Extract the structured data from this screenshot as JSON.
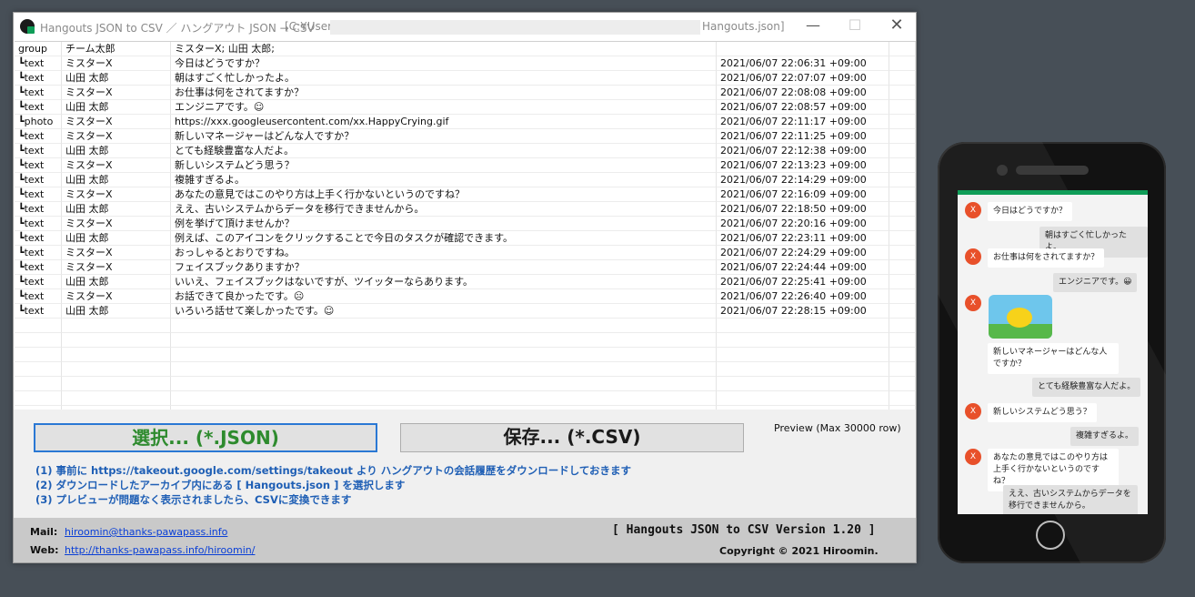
{
  "window": {
    "title": "Hangouts JSON to CSV ／ ハングアウト JSON → CSV",
    "path_prefix": "[C:¥Users",
    "path_suffix": "Hangouts.json]",
    "minimize": "—",
    "maximize": "☐",
    "close": "✕"
  },
  "grid": {
    "rows": [
      {
        "type": "group",
        "user": "チーム太郎",
        "text": "ミスターX; 山田 太郎;",
        "time": ""
      },
      {
        "type": "┗text",
        "user": "ミスターX",
        "text": "今日はどうですか？",
        "time": "2021/06/07 22:06:31 +09:00"
      },
      {
        "type": "┗text",
        "user": "山田 太郎",
        "text": "朝はすごく忙しかったよ。",
        "time": "2021/06/07 22:07:07 +09:00"
      },
      {
        "type": "┗text",
        "user": "ミスターX",
        "text": "お仕事は何をされてますか？",
        "time": "2021/06/07 22:08:08 +09:00"
      },
      {
        "type": "┗text",
        "user": "山田 太郎",
        "text": "エンジニアです。☺",
        "time": "2021/06/07 22:08:57 +09:00"
      },
      {
        "type": "┗photo",
        "user": "ミスターX",
        "text": "https://xxx.googleusercontent.com/xx.HappyCrying.gif",
        "time": "2021/06/07 22:11:17 +09:00"
      },
      {
        "type": "┗text",
        "user": "ミスターX",
        "text": "新しいマネージャーはどんな人ですか？",
        "time": "2021/06/07 22:11:25 +09:00"
      },
      {
        "type": "┗text",
        "user": "山田 太郎",
        "text": "とても経験豊富な人だよ。",
        "time": "2021/06/07 22:12:38 +09:00"
      },
      {
        "type": "┗text",
        "user": "ミスターX",
        "text": "新しいシステムどう思う？",
        "time": "2021/06/07 22:13:23 +09:00"
      },
      {
        "type": "┗text",
        "user": "山田 太郎",
        "text": "複雑すぎるよ。",
        "time": "2021/06/07 22:14:29 +09:00"
      },
      {
        "type": "┗text",
        "user": "ミスターX",
        "text": "あなたの意見ではこのやり方は上手く行かないというのですね？",
        "time": "2021/06/07 22:16:09 +09:00"
      },
      {
        "type": "┗text",
        "user": "山田 太郎",
        "text": "ええ、古いシステムからデータを移行できませんから。",
        "time": "2021/06/07 22:18:50 +09:00"
      },
      {
        "type": "┗text",
        "user": "ミスターX",
        "text": "例を挙げて頂けませんか？",
        "time": "2021/06/07 22:20:16 +09:00"
      },
      {
        "type": "┗text",
        "user": "山田 太郎",
        "text": "例えば、このアイコンをクリックすることで今日のタスクが確認できます。",
        "time": "2021/06/07 22:23:11 +09:00"
      },
      {
        "type": "┗text",
        "user": "ミスターX",
        "text": "おっしゃるとおりですね。",
        "time": "2021/06/07 22:24:29 +09:00"
      },
      {
        "type": "┗text",
        "user": "ミスターX",
        "text": "フェイスブックありますか？",
        "time": "2021/06/07 22:24:44 +09:00"
      },
      {
        "type": "┗text",
        "user": "山田 太郎",
        "text": "いいえ、フェイスブックはないですが、ツイッターならあります。",
        "time": "2021/06/07 22:25:41 +09:00"
      },
      {
        "type": "┗text",
        "user": "ミスターX",
        "text": "お話できて良かったです。☹",
        "time": "2021/06/07 22:26:40 +09:00"
      },
      {
        "type": "┗text",
        "user": "山田 太郎",
        "text": "いろいろ話せて楽しかったです。☺",
        "time": "2021/06/07 22:28:15 +09:00"
      },
      {
        "type": "",
        "user": "",
        "text": "",
        "time": ""
      },
      {
        "type": "",
        "user": "",
        "text": "",
        "time": ""
      },
      {
        "type": "",
        "user": "",
        "text": "",
        "time": ""
      },
      {
        "type": "",
        "user": "",
        "text": "",
        "time": ""
      },
      {
        "type": "",
        "user": "",
        "text": "",
        "time": ""
      },
      {
        "type": "",
        "user": "",
        "text": "",
        "time": ""
      },
      {
        "type": "",
        "user": "",
        "text": "",
        "time": ""
      }
    ]
  },
  "panel": {
    "open_button": "選択... (*.JSON)",
    "save_button": "保存... (*.CSV)",
    "preview_label": "Preview (Max 30000 row)",
    "steps": [
      "(1) 事前に https://takeout.google.com/settings/takeout より ハングアウトの会話履歴をダウンロードしておきます",
      "(2) ダウンロードしたアーカイブ内にある [ Hangouts.json ] を選択します",
      "(3) プレビューが問題なく表示されましたら、CSVに変換できます"
    ]
  },
  "footer": {
    "mail_label": "Mail:",
    "mail": "hiroomin@thanks-pawapass.info",
    "web_label": "Web:",
    "web": "http://thanks-pawapass.info/hiroomin/",
    "version": "[ Hangouts JSON to CSV Version 1.20 ]",
    "copyright": "Copyright © 2021 Hiroomin."
  },
  "phone": {
    "avatar_letter": "X",
    "messages": [
      "今日はどうですか？",
      "朝はすごく忙しかったよ。",
      "お仕事は何をされてますか？",
      "エンジニアです。😀",
      "新しいマネージャーはどんな人ですか？",
      "とても経験豊富な人だよ。",
      "新しいシステムどう思う？",
      "複雑すぎるよ。",
      "あなたの意見ではこのやり方は上手く行かないというのですね？",
      "ええ、古いシステムからデータを移行できませんから。"
    ]
  }
}
